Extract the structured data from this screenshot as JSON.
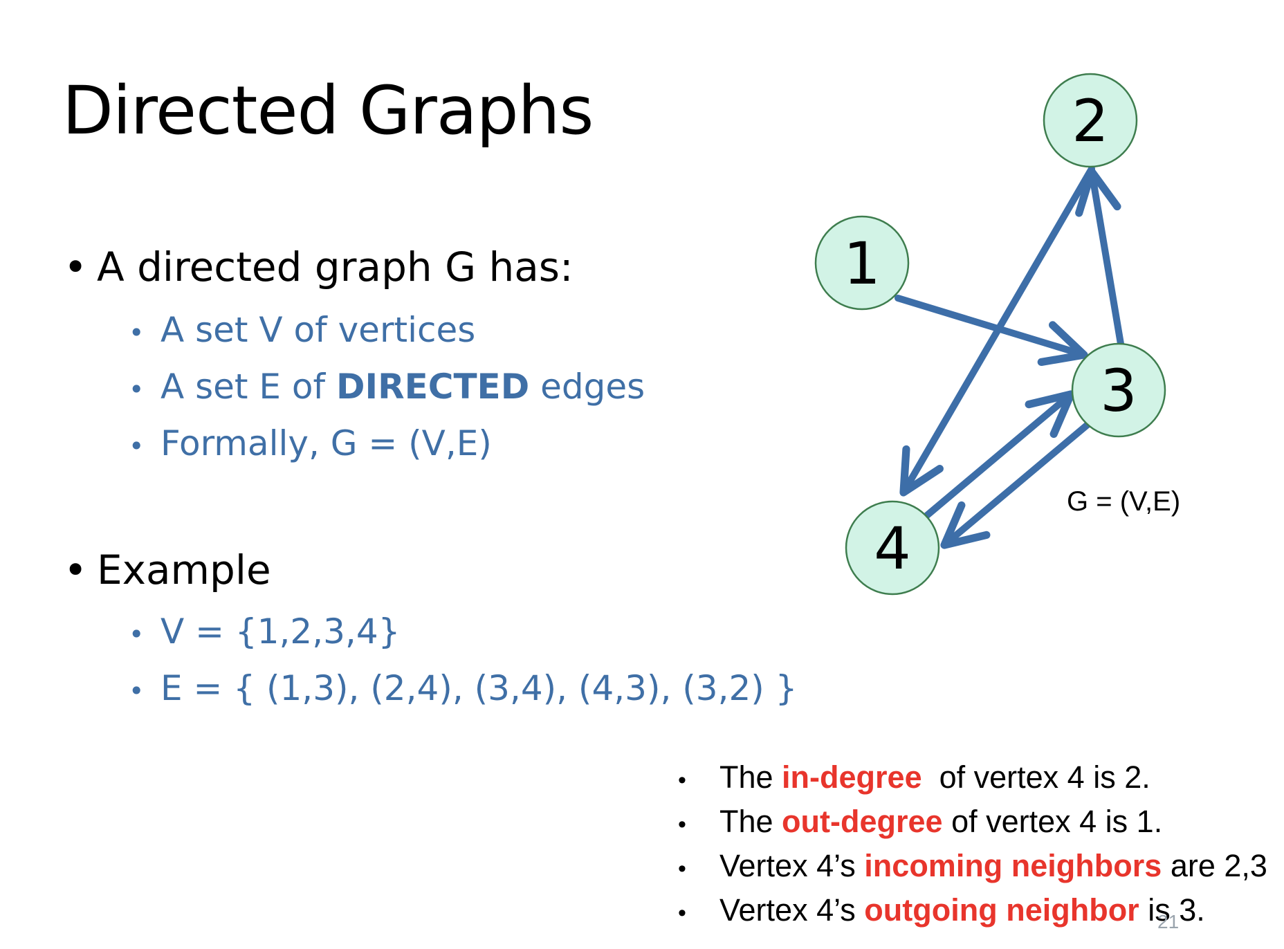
{
  "title": "Directed Graphs",
  "definition": {
    "heading": "A directed graph G has:",
    "items": [
      {
        "pre": "A set V of vertices",
        "bold": "",
        "post": ""
      },
      {
        "pre": "A set E of ",
        "bold": "DIRECTED",
        "post": " edges"
      },
      {
        "pre": "Formally, G = (V,E)",
        "bold": "",
        "post": ""
      }
    ]
  },
  "example": {
    "heading": "Example",
    "items": [
      "V = {1,2,3,4}",
      "E = { (1,3), (2,4), (3,4), (4,3), (3,2) }"
    ]
  },
  "graph": {
    "label": "G = (V,E)",
    "colors": {
      "node_fill": "#d2f3e6",
      "node_stroke": "#3e7d4e",
      "edge": "#3d6ea8"
    },
    "nodes": [
      {
        "id": "1",
        "label": "1"
      },
      {
        "id": "2",
        "label": "2"
      },
      {
        "id": "3",
        "label": "3"
      },
      {
        "id": "4",
        "label": "4"
      }
    ],
    "edges": [
      {
        "from": "1",
        "to": "3"
      },
      {
        "from": "2",
        "to": "4"
      },
      {
        "from": "3",
        "to": "4"
      },
      {
        "from": "4",
        "to": "3"
      },
      {
        "from": "3",
        "to": "2"
      }
    ]
  },
  "notes": [
    {
      "pre": "The ",
      "highlight": "in-degree",
      "post": "  of vertex 4 is 2."
    },
    {
      "pre": "The ",
      "highlight": "out-degree",
      "post": " of vertex 4 is 1."
    },
    {
      "pre": "Vertex 4’s ",
      "highlight": "incoming neighbors",
      "post": " are 2,3"
    },
    {
      "pre": "Vertex 4’s ",
      "highlight": "outgoing neighbor",
      "post": " is 3."
    }
  ],
  "page_number": "21",
  "accent_colors": {
    "body_blue": "#3f6fa6",
    "highlight_red": "#e8352c"
  }
}
